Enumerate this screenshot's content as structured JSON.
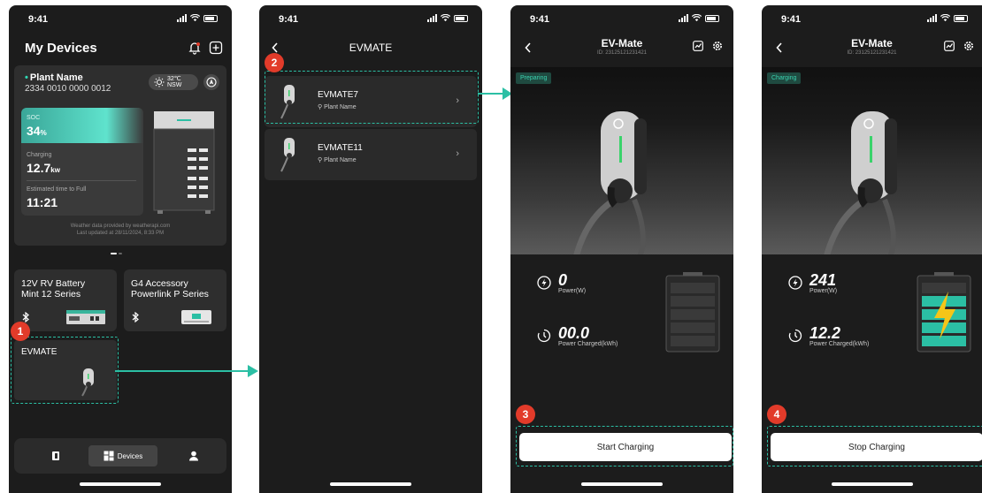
{
  "status_time": "9:41",
  "screen1": {
    "title": "My Devices",
    "plant": {
      "name": "Plant Name",
      "serial": "2334 0010 0000 0012",
      "weather_temp": "32℃",
      "weather_region": "NSW",
      "soc_label": "SOC",
      "soc_value": "34",
      "soc_unit": "%",
      "charging_label": "Charging",
      "charging_value": "12.7",
      "charging_unit": "kw",
      "est_label": "Estimated time to Full",
      "est_value": "11:21",
      "weather_note_line1": "Weather data provided by weatherapi.com",
      "weather_note_line2": "Last updated at 28/11/2024, 8:33 PM"
    },
    "devices": [
      {
        "line1": "12V RV Battery",
        "line2": "Mint 12 Series"
      },
      {
        "line1": "G4 Accessory",
        "line2": "Powerlink P Series"
      }
    ],
    "evmate_card": "EVMATE",
    "tabs": {
      "devices": "Devices"
    },
    "marker": "1"
  },
  "screen2": {
    "title": "EVMATE",
    "items": [
      {
        "name": "EVMATE7",
        "location": "Plant Name"
      },
      {
        "name": "EVMATE11",
        "location": "Plant Name"
      }
    ],
    "marker": "2"
  },
  "screen3": {
    "title": "EV-Mate",
    "device_id": "ID: 23125121231421",
    "status": "Preparing",
    "power_value": "0",
    "power_label": "Power(W)",
    "energy_value": "00.0",
    "energy_label": "Power Charged(kWh)",
    "action": "Start  Charging",
    "marker": "3"
  },
  "screen4": {
    "title": "EV-Mate",
    "device_id": "ID: 23125121231421",
    "status": "Charging",
    "power_value": "241",
    "power_label": "Power(W)",
    "energy_value": "12.2",
    "energy_label": "Power Charged(kWh)",
    "action": "Stop Charging",
    "marker": "4"
  },
  "colors": {
    "accent": "#2bbfa4",
    "marker": "#e23b2a",
    "phone_bg": "#1c1c1c",
    "card_bg": "#2e2e2e",
    "lightning": "#f5c518"
  }
}
